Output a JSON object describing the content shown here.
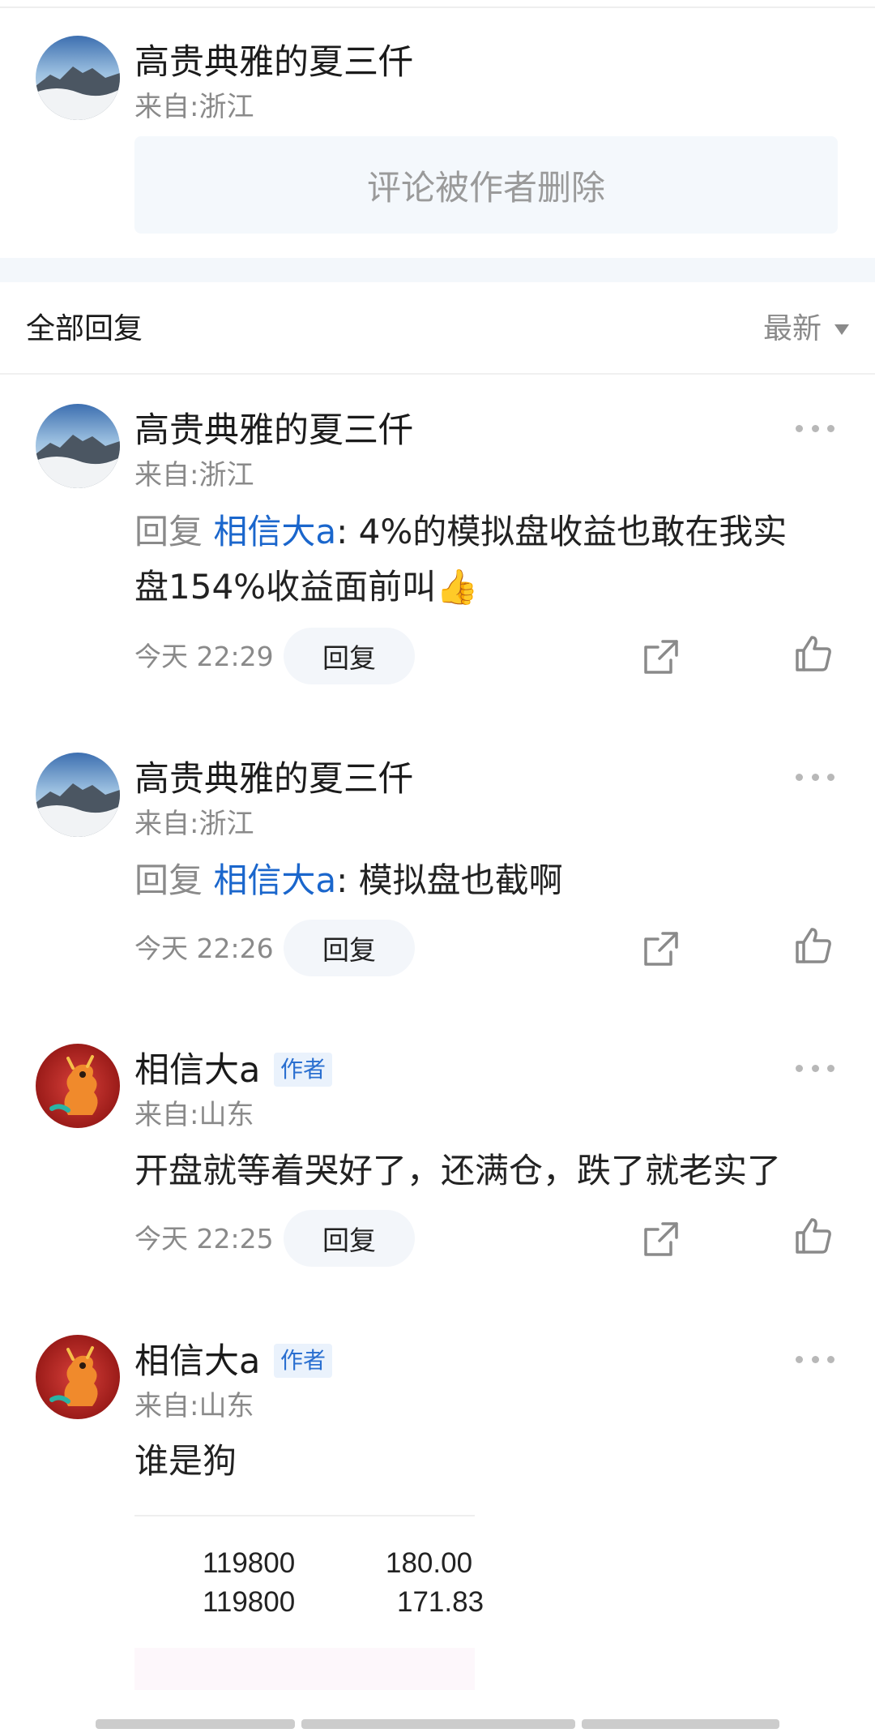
{
  "top_comment": {
    "user": "高贵典雅的夏三仟",
    "from": "来自:浙江",
    "deleted_text": "评论被作者删除"
  },
  "replies_header": {
    "title": "全部回复",
    "sort_label": "最新"
  },
  "replies": [
    {
      "user": "高贵典雅的夏三仟",
      "from": "来自:浙江",
      "reply_prefix": "回复",
      "mention": "相信大a",
      "text_line1": ": 4%的模拟盘收益也敢在我实",
      "text_line2": "盘154%收益面前叫👍",
      "time": "今天 22:29",
      "reply_btn": "回复"
    },
    {
      "user": "高贵典雅的夏三仟",
      "from": "来自:浙江",
      "reply_prefix": "回复",
      "mention": "相信大a",
      "text_line1": ": 模拟盘也截啊",
      "time": "今天 22:26",
      "reply_btn": "回复"
    },
    {
      "user": "相信大a",
      "badge": "作者",
      "from": "来自:山东",
      "text_line1": "开盘就等着哭好了，还满仓，跌了就老实了",
      "time": "今天 22:25",
      "reply_btn": "回复"
    },
    {
      "user": "相信大a",
      "badge": "作者",
      "from": "来自:山东",
      "text_line1": "谁是狗",
      "image_rows": [
        {
          "code": "119800",
          "value": "180.00"
        },
        {
          "code": "119800",
          "value": "171.83"
        }
      ]
    }
  ],
  "icons": {
    "more": "more-dots-icon",
    "share": "share-icon",
    "like": "thumb-up-icon"
  },
  "colors": {
    "mention": "#1a66cc",
    "badge_bg": "#eaf2fc",
    "badge_text": "#2a6fd0",
    "muted": "#8a8a8a"
  }
}
